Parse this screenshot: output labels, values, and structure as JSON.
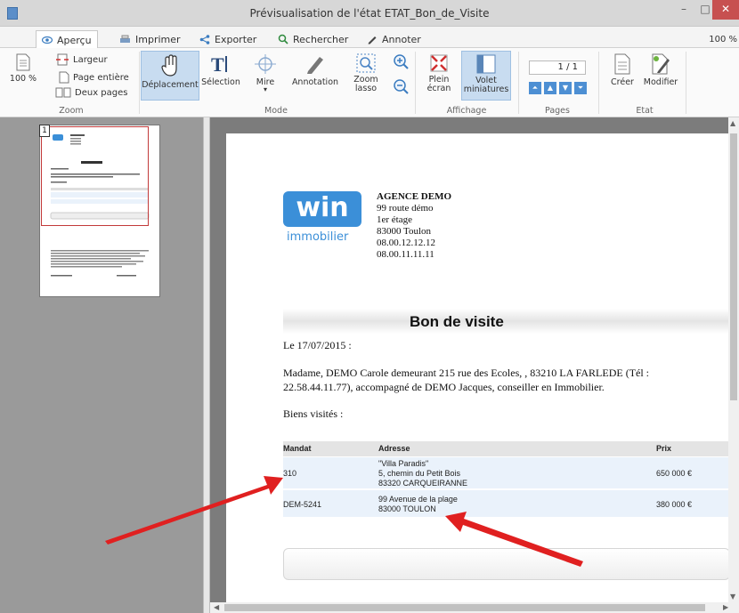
{
  "window": {
    "title": "Prévisualisation de l'état ETAT_Bon_de_Visite",
    "minimize": "–",
    "maximize": "□",
    "close": "✕"
  },
  "tabs": [
    {
      "label": "Aperçu",
      "icon": "eye-icon"
    },
    {
      "label": "Imprimer",
      "icon": "printer-icon"
    },
    {
      "label": "Exporter",
      "icon": "share-icon"
    },
    {
      "label": "Rechercher",
      "icon": "search-icon"
    },
    {
      "label": "Annoter",
      "icon": "pen-icon"
    }
  ],
  "zoom_level": "100 %",
  "ribbon": {
    "zoom": {
      "group": "Zoom",
      "percent": "100 %",
      "largeur": "Largeur",
      "page_entiere": "Page entière",
      "deux_pages": "Deux pages"
    },
    "mode": {
      "group": "Mode",
      "deplacement": "Déplacement",
      "selection": "Sélection",
      "mire": "Mire",
      "annotation": "Annotation",
      "zoom_lasso_1": "Zoom",
      "zoom_lasso_2": "lasso"
    },
    "affichage": {
      "group": "Affichage",
      "plein_1": "Plein",
      "plein_2": "écran",
      "volet_1": "Volet",
      "volet_2": "miniatures"
    },
    "pages": {
      "group": "Pages",
      "counter": "1 / 1"
    },
    "etat": {
      "group": "Etat",
      "creer": "Créer",
      "modifier": "Modifier"
    }
  },
  "thumbnail": {
    "page_number": "1"
  },
  "document": {
    "logo_text": "win",
    "logo_sub": "immobilier",
    "agency_name": "AGENCE DEMO",
    "agency_lines": [
      "99 route démo",
      "1er étage",
      "83000 Toulon",
      "08.00.12.12.12",
      "08.00.11.11.11"
    ],
    "title": "Bon de visite",
    "date_line": "Le 17/07/2015 :",
    "paragraph_1": "Madame, DEMO Carole demeurant 215 rue des Ecoles, , 83210 LA FARLEDE   (Tél :",
    "paragraph_2": "22.58.44.11.77), accompagné de DEMO Jacques, conseiller en Immobilier.",
    "biens_label": "Biens visités :",
    "table": {
      "headers": [
        "Mandat",
        "Adresse",
        "Prix"
      ],
      "rows": [
        {
          "mandat": "310",
          "adresse": [
            "\"Villa Paradis\"",
            "5, chemin du Petit Bois",
            "83320 CARQUEIRANNE"
          ],
          "prix": "650 000 €"
        },
        {
          "mandat": "DEM-5241",
          "adresse": [
            "99 Avenue de la plage",
            "83000 TOULON"
          ],
          "prix": "380 000 €"
        }
      ]
    }
  },
  "colors": {
    "accent": "#3b8fd8",
    "arrow": "#e02020",
    "selected_button": "#c8dcf0",
    "close_button": "#c75050"
  }
}
